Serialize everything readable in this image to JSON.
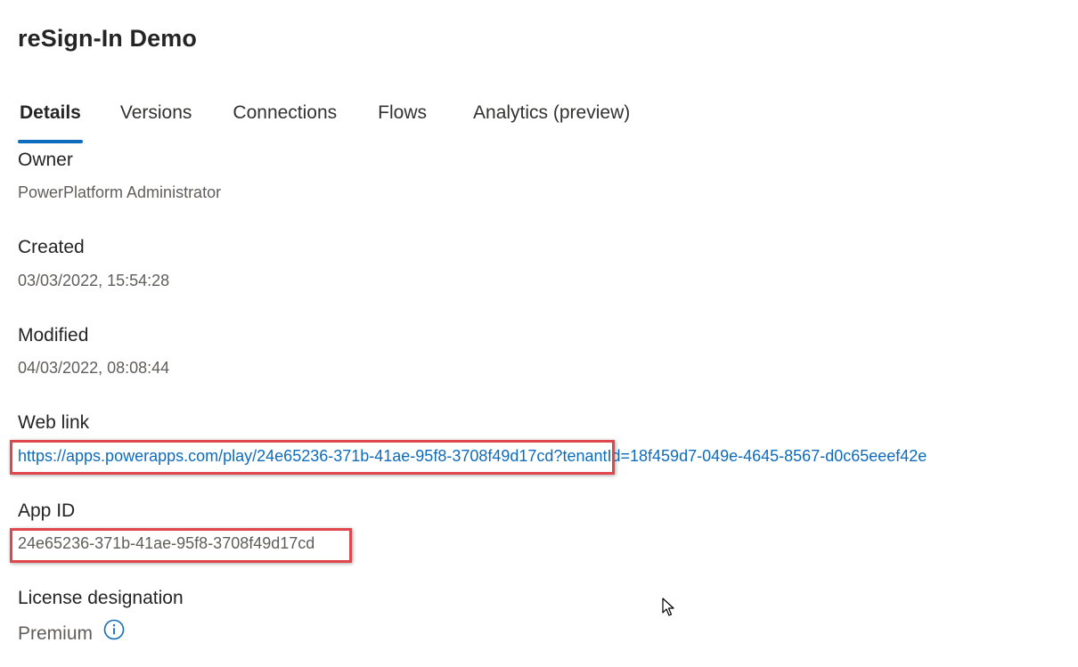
{
  "app": {
    "title": "reSign-In Demo"
  },
  "tabs": [
    {
      "label": "Details",
      "active": true
    },
    {
      "label": "Versions",
      "active": false
    },
    {
      "label": "Connections",
      "active": false
    },
    {
      "label": "Flows",
      "active": false
    },
    {
      "label": "Analytics (preview)",
      "active": false
    }
  ],
  "details": {
    "owner": {
      "label": "Owner",
      "value": "PowerPlatform Administrator"
    },
    "created": {
      "label": "Created",
      "value": "03/03/2022, 15:54:28"
    },
    "modified": {
      "label": "Modified",
      "value": "04/03/2022, 08:08:44"
    },
    "web_link": {
      "label": "Web link",
      "value": "https://apps.powerapps.com/play/24e65236-371b-41ae-95f8-3708f49d17cd?tenantId=18f459d7-049e-4645-8567-d0c65eeef42e"
    },
    "app_id": {
      "label": "App ID",
      "value": "24e65236-371b-41ae-95f8-3708f49d17cd"
    },
    "license": {
      "label": "License designation",
      "value": "Premium"
    }
  },
  "icons": {
    "info": "info-circle-icon",
    "cursor": "mouse-pointer-icon"
  },
  "colors": {
    "accent": "#0f6cbd",
    "highlight": "#e0474c",
    "muted_text": "#605e5c"
  }
}
